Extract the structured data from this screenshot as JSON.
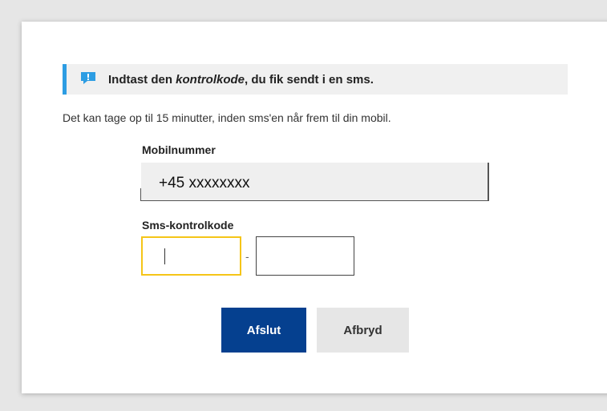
{
  "notice": {
    "icon": "exclamation-speech-bubble-icon",
    "text_before": "Indtast den ",
    "text_emphasis": "kontrolkode",
    "text_after": ", du fik sendt i en sms.",
    "icon_color": "#2d9de3",
    "accent_color": "#2d9de3"
  },
  "info_text": "Det kan tage op til 15 minutter, inden sms'en når frem til din mobil.",
  "phone": {
    "label": "Mobilnummer",
    "value": "+45 xxxxxxxx"
  },
  "code": {
    "label": "Sms-kontrolkode",
    "separator": "-",
    "part1_value": "",
    "part2_value": "",
    "focus_color": "#f5c518"
  },
  "buttons": {
    "finish_label": "Afslut",
    "cancel_label": "Afbryd",
    "primary_color": "#05408f"
  }
}
